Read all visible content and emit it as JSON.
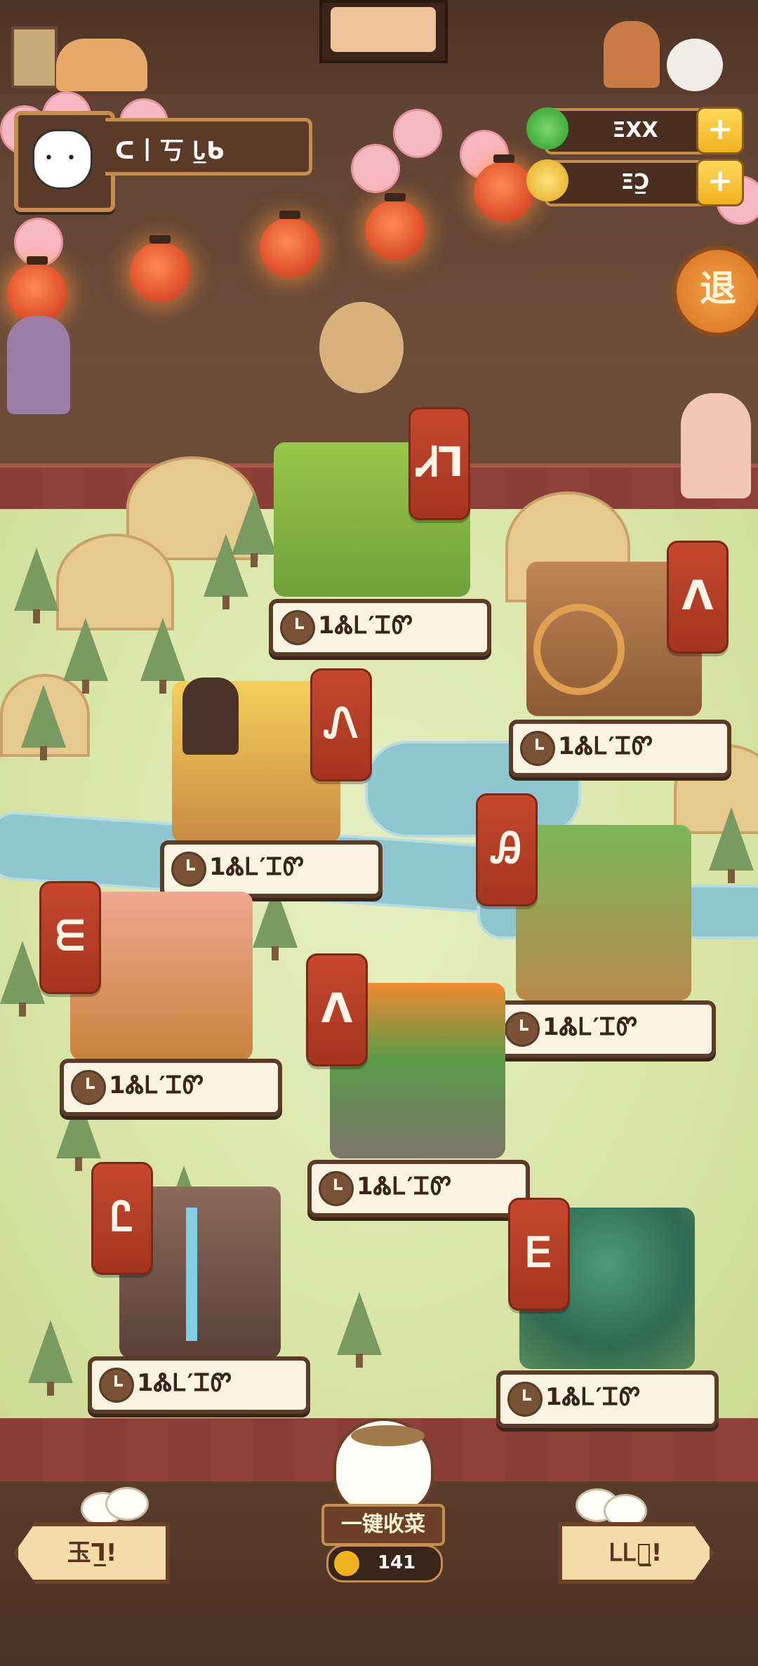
{
  "top": {
    "player_name": "ᑕ丨丂 Ꮣ̲ᑲ",
    "jade_value": "ΞXX",
    "coin_value": "ΞƆ̲",
    "exit_label": "退"
  },
  "plots": [
    {
      "banner": "Ꮧꓶ",
      "timer": "1ᏜᏞ′ᏆᏛ"
    },
    {
      "banner": "ᐱ",
      "timer": "1ᏜᏞ′ᏆᏛ"
    },
    {
      "banner": "Ꮑ",
      "timer": "1ᏜᏞ′ᏆᏛ"
    },
    {
      "banner": "Ꭿ",
      "timer": "1ᏜᏞ′ᏆᏛ"
    },
    {
      "banner": "ᗴ",
      "timer": "1ᏜᏞ′ᏆᏛ"
    },
    {
      "banner": "ᐱ",
      "timer": "1ᏜᏞ′ᏆᏛ"
    },
    {
      "banner": "Ꮭ",
      "timer": "1ᏜᏞ′ᏆᏛ"
    },
    {
      "banner": "Ꭼ",
      "timer": "1ᏜᏞ′ᏆᏛ"
    }
  ],
  "bottom": {
    "left_button": "玉ᒣ̲!",
    "right_button": "ᏞᏞ料̲!",
    "harvest_all_label": "一键收菜",
    "harvest_count": "141"
  },
  "colors": {
    "banner": "#b43b24",
    "timer_bg": "#fbf3e2",
    "frame": "#5a3b28",
    "meadow": "#dbe6a9",
    "river": "#8fc6cf"
  },
  "icons": {
    "jade": "jade-coin-icon",
    "coin": "gold-coin-icon",
    "clock": "clock-icon"
  }
}
